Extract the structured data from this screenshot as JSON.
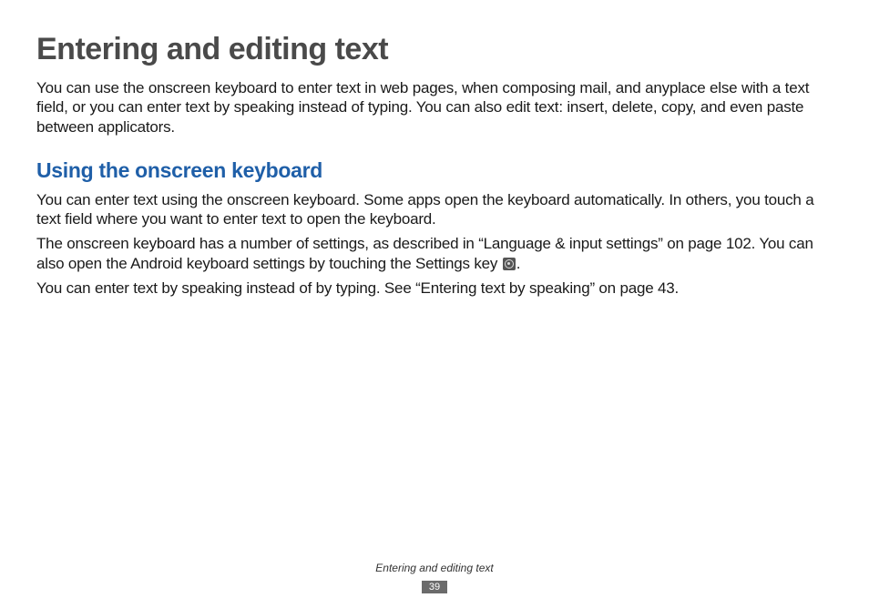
{
  "page": {
    "title": "Entering and editing text",
    "intro": "You can use the onscreen keyboard to enter text in web pages, when composing mail, and anyplace else with a text field, or you can enter text by speaking instead of typing. You can also edit text: insert, delete, copy, and even paste between applicators."
  },
  "section": {
    "heading": "Using the onscreen keyboard",
    "p1": "You can enter text using the onscreen keyboard. Some apps open the keyboard automatically. In others, you touch a text field where you want to enter text to open the keyboard.",
    "p2a": "The onscreen keyboard has a number of settings, as described in “Language & input settings” on page 102. You can also open the Android keyboard settings by touching the Settings key ",
    "p2b": ".",
    "p3": "You can enter text by speaking instead of by typing. See “Entering text by speaking” on page 43."
  },
  "footer": {
    "label": "Entering and editing text",
    "pageNumber": "39"
  }
}
